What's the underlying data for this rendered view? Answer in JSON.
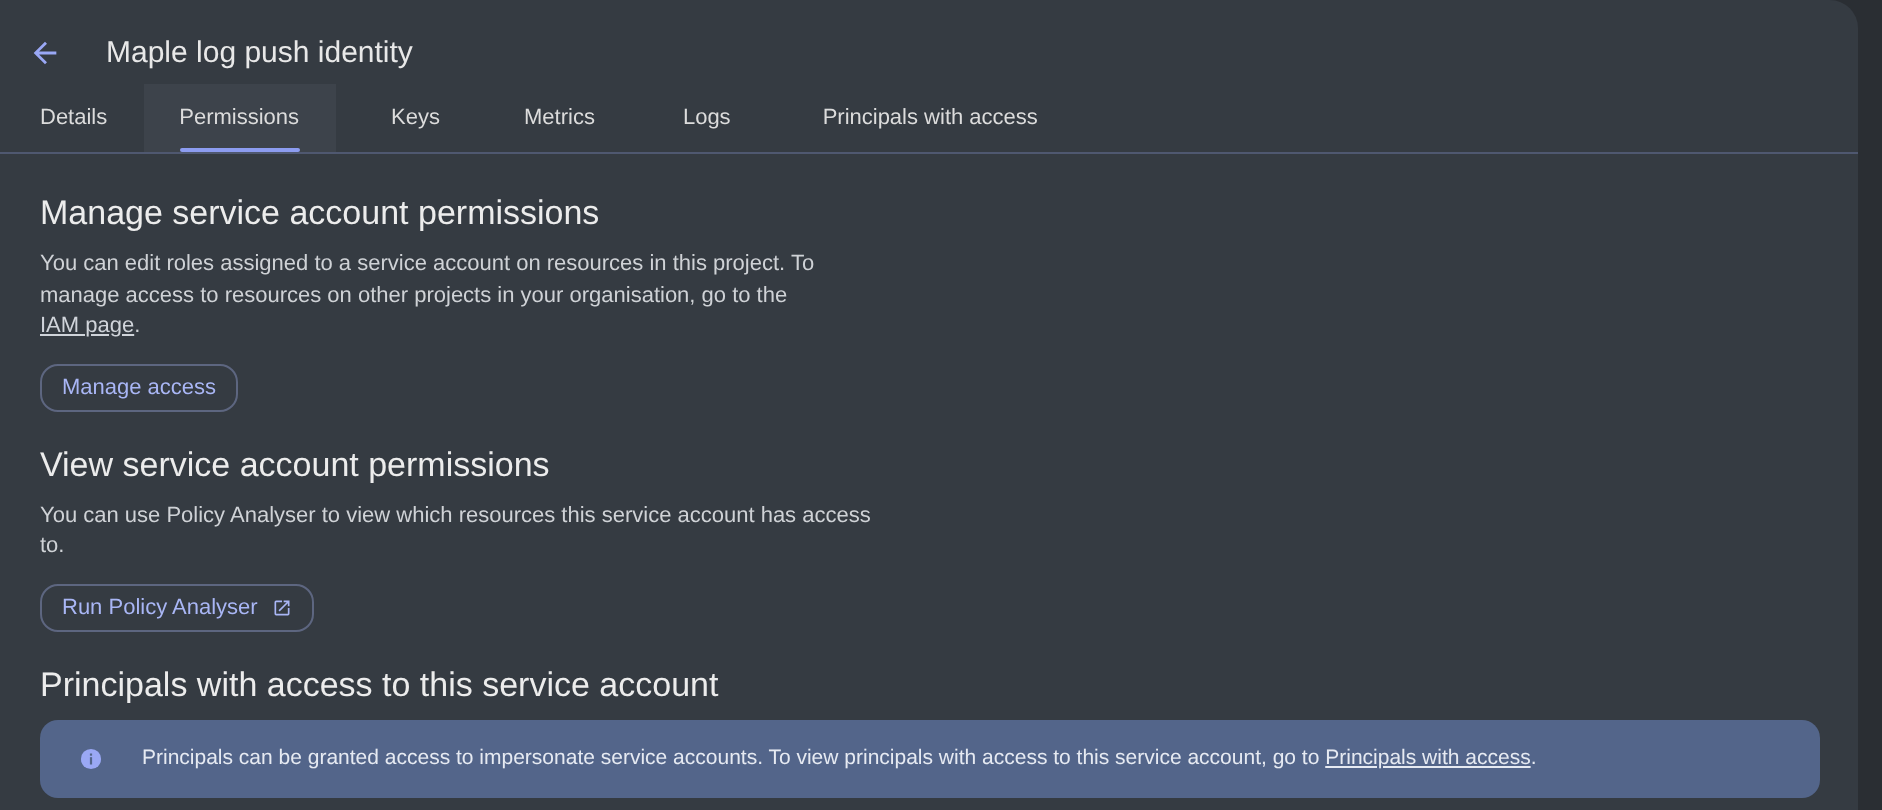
{
  "header": {
    "title": "Maple log push identity"
  },
  "tabs": [
    {
      "label": "Details",
      "selected": false
    },
    {
      "label": "Permissions",
      "selected": true
    },
    {
      "label": "Keys",
      "selected": false
    },
    {
      "label": "Metrics",
      "selected": false
    },
    {
      "label": "Logs",
      "selected": false
    },
    {
      "label": "Principals with access",
      "selected": false
    }
  ],
  "sections": [
    {
      "heading": "Manage service account permissions",
      "text": "You can edit roles assigned to a service account on resources in this project. To manage access to resources on other projects in your organisation, go to the ",
      "link": "IAM page",
      "text_after": ".",
      "button": {
        "label": "Manage access",
        "external": false
      }
    },
    {
      "heading": "View service account permissions",
      "text": "You can use Policy Analyser to view which resources this service account has access to.",
      "button": {
        "label": "Run Policy Analyser",
        "external": true
      }
    },
    {
      "heading": "Principals with access to this service account",
      "banner": {
        "text": "Principals can be granted access to impersonate service accounts. To view principals with access to this service account, go to ",
        "link": "Principals with access",
        "text_after": "."
      }
    }
  ]
}
